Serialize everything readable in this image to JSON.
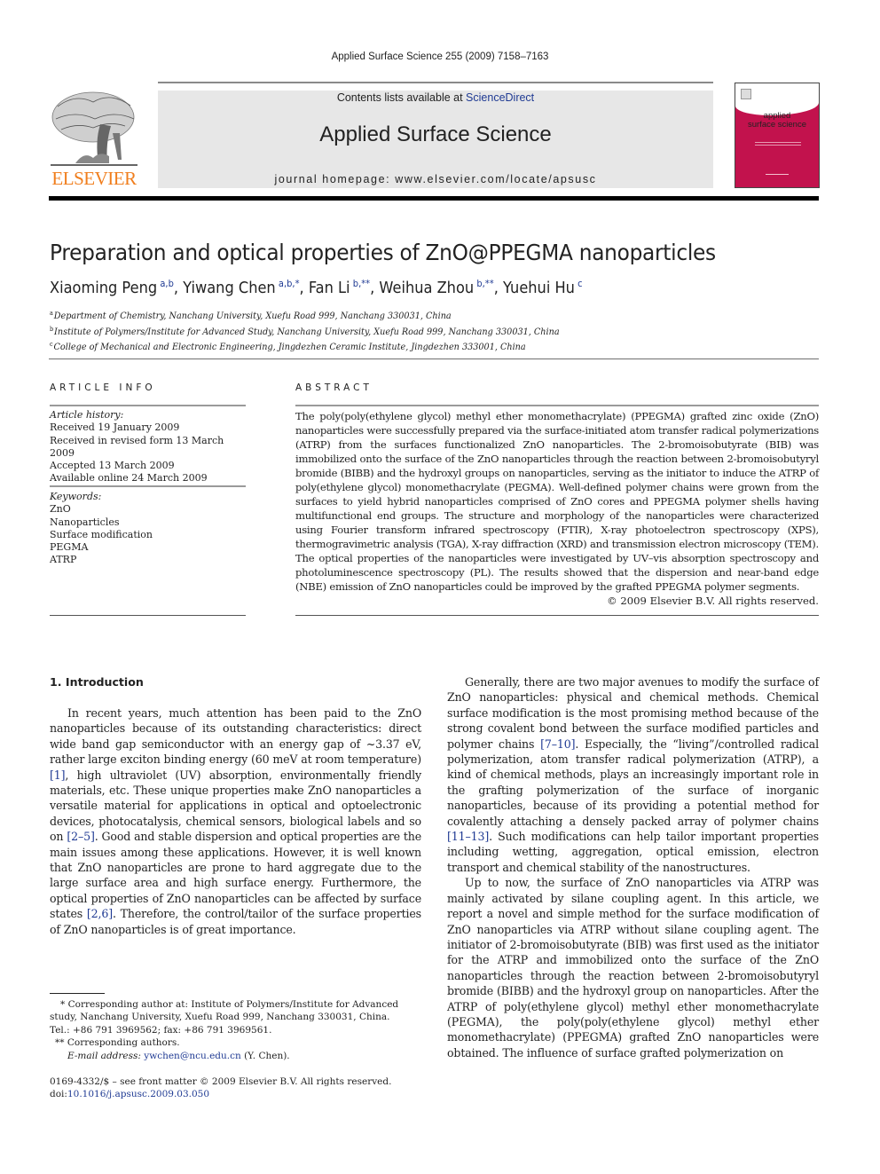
{
  "header": {
    "running_head": "Applied Surface Science 255 (2009) 7158–7163",
    "contents_prefix": "Contents lists available at ",
    "contents_link": "ScienceDirect",
    "journal_title": "Applied Surface Science",
    "homepage": "journal homepage: www.elsevier.com/locate/apsusc",
    "publisher_logo_text": "ELSEVIER",
    "cover_title_line1": "applied",
    "cover_title_line2": "surface science",
    "colors": {
      "publisher_orange": "#f07e1d",
      "link_blue": "#1f3a93",
      "cover_magenta": "#c2124d",
      "banner_gray": "#e7e7e7"
    }
  },
  "article": {
    "title": "Preparation and optical properties of ZnO@PPEGMA nanoparticles",
    "authors": [
      {
        "name": "Xiaoming Peng",
        "sup": "a,b",
        "sep": ", "
      },
      {
        "name": "Yiwang Chen",
        "sup": "a,b,*",
        "sep": ", "
      },
      {
        "name": "Fan Li",
        "sup": "b,**",
        "sep": ", "
      },
      {
        "name": "Weihua Zhou",
        "sup": "b,**",
        "sep": ", "
      },
      {
        "name": "Yuehui Hu",
        "sup": "c",
        "sep": ""
      }
    ],
    "affiliations": [
      {
        "mark": "a",
        "text": "Department of Chemistry, Nanchang University, Xuefu Road 999, Nanchang 330031, China"
      },
      {
        "mark": "b",
        "text": "Institute of Polymers/Institute for Advanced Study, Nanchang University, Xuefu Road 999, Nanchang 330031, China"
      },
      {
        "mark": "c",
        "text": "College of Mechanical and Electronic Engineering, Jingdezhen Ceramic Institute, Jingdezhen 333001, China"
      }
    ]
  },
  "article_info": {
    "heading": "ARTICLE INFO",
    "history_label": "Article history:",
    "history": [
      "Received 19 January 2009",
      "Received in revised form 13 March 2009",
      "Accepted 13 March 2009",
      "Available online 24 March 2009"
    ],
    "keywords_label": "Keywords:",
    "keywords": [
      "ZnO",
      "Nanoparticles",
      "Surface modification",
      "PEGMA",
      "ATRP"
    ]
  },
  "abstract": {
    "heading": "ABSTRACT",
    "text": "The poly(poly(ethylene glycol) methyl ether monomethacrylate) (PPEGMA) grafted zinc oxide (ZnO) nanoparticles were successfully prepared via the surface-initiated atom transfer radical polymerizations (ATRP) from the surfaces functionalized ZnO nanoparticles. The 2-bromoisobutyrate (BIB) was immobilized onto the surface of the ZnO nanoparticles through the reaction between 2-bromoisobutyryl bromide (BIBB) and the hydroxyl groups on nanoparticles, serving as the initiator to induce the ATRP of poly(ethylene glycol) monomethacrylate (PEGMA). Well-defined polymer chains were grown from the surfaces to yield hybrid nanoparticles comprised of ZnO cores and PPEGMA polymer shells having multifunctional end groups. The structure and morphology of the nanoparticles were characterized using Fourier transform infrared spectroscopy (FTIR), X-ray photoelectron spectroscopy (XPS), thermogravimetric analysis (TGA), X-ray diffraction (XRD) and transmission electron microscopy (TEM). The optical properties of the nanoparticles were investigated by UV–vis absorption spectroscopy and photoluminescence spectroscopy (PL). The results showed that the dispersion and near-band edge (NBE) emission of ZnO nanoparticles could be improved by the grafted PPEGMA polymer segments.",
    "copyright": "© 2009 Elsevier B.V. All rights reserved."
  },
  "body": {
    "section_heading": "1.  Introduction",
    "left_para": [
      "In recent years, much attention has been paid to the ZnO nanoparticles because of its outstanding characteristics: direct wide band gap semiconductor with an energy gap of ~3.37 eV, rather large exciton binding energy (60 meV at room temperature) ",
      "[1]",
      ", high ultraviolet (UV) absorption, environmentally friendly materials, etc. These unique properties make ZnO nanoparticles a versatile material for applications in optical and optoelectronic devices, photocatalysis, chemical sensors, biological labels and so on ",
      "[2–5]",
      ". Good and stable dispersion and optical properties are the main issues among these applications. However, it is well known that ZnO nanoparticles are prone to hard aggregate due to the large surface area and high surface energy. Furthermore, the optical properties of ZnO nanoparticles can be affected by surface states ",
      "[2,6]",
      ". Therefore, the control/tailor of the surface properties of ZnO nanoparticles is of great importance."
    ],
    "right_para1": [
      "Generally, there are two major avenues to modify the surface of ZnO nanoparticles: physical and chemical methods. Chemical surface modification is the most promising method because of the strong covalent bond between the surface modified particles and polymer chains ",
      "[7–10]",
      ". Especially, the “living”/controlled radical polymerization, atom transfer radical polymerization (ATRP), a kind of chemical methods, plays an increasingly important role in the grafting polymerization of the surface of inorganic nanoparticles, because of its providing a potential method for covalently attaching a densely packed array of polymer chains ",
      "[11–13]",
      ". Such modifications can help tailor important properties including wetting, aggregation, optical emission, electron transport and chemical stability of the nanostructures."
    ],
    "right_para2": "Up to now, the surface of ZnO nanoparticles via ATRP was mainly activated by silane coupling agent. In this article, we report a novel and simple method for the surface modification of ZnO nanoparticles via ATRP without silane coupling agent. The initiator of 2-bromoisobutyrate (BIB) was first used as the initiator for the ATRP and immobilized onto the surface of the ZnO nanoparticles through the reaction between 2-bromoisobutyryl bromide (BIBB) and the hydroxyl group on nanoparticles. After the ATRP of poly(ethylene glycol) methyl ether monomethacrylate (PEGMA), the poly(poly(ethylene glycol) methyl ether monomethacrylate) (PPEGMA) grafted ZnO nanoparticles were obtained. The influence of surface grafted polymerization on"
  },
  "footnotes": {
    "corr1": "* Corresponding author at: Institute of Polymers/Institute for Advanced study, Nanchang University, Xuefu Road 999, Nanchang 330031, China.",
    "tel": "Tel.: +86 791 3969562; fax: +86 791 3969561.",
    "corr2": "** Corresponding authors.",
    "email_label": "E-mail address: ",
    "email": "ywchen@ncu.edu.cn",
    "email_owner": " (Y. Chen).",
    "front_matter": "0169-4332/$ – see front matter © 2009 Elsevier B.V. All rights reserved.",
    "doi_prefix": "doi:",
    "doi": "10.1016/j.apsusc.2009.03.050"
  }
}
